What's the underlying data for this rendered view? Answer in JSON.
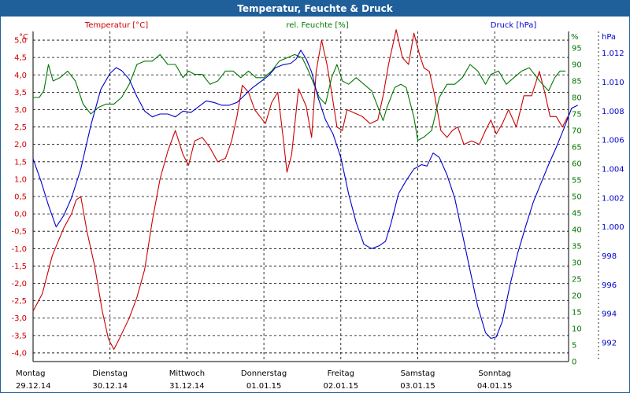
{
  "window": {
    "title": "Temperatur, Feuchte & Druck"
  },
  "colors": {
    "temperature": "#cc0000",
    "humidity": "#007700",
    "pressure": "#0000cc",
    "titlebar": "#1f5f9a",
    "grid": "#000000"
  },
  "chart_data": {
    "type": "line",
    "title": "Temperatur, Feuchte & Druck",
    "x_ticks": [
      {
        "day": "Montag",
        "date": "29.12.14"
      },
      {
        "day": "Dienstag",
        "date": "30.12.14"
      },
      {
        "day": "Mittwoch",
        "date": "31.12.14"
      },
      {
        "day": "Donnerstag",
        "date": "01.01.15"
      },
      {
        "day": "Freitag",
        "date": "02.01.15"
      },
      {
        "day": "Samstag",
        "date": "03.01.15"
      },
      {
        "day": "Sonntag",
        "date": "04.01.15"
      }
    ],
    "x_range_days": [
      0,
      7.1
    ],
    "axes": {
      "temperature": {
        "label": "Temperatur [°C]",
        "unit": "°C",
        "range": [
          -4.25,
          5.25
        ],
        "ticks": [
          "5,0",
          "4,5",
          "4,0",
          "3,5",
          "3,0",
          "2,5",
          "2,0",
          "1,5",
          "1,0",
          "0,5",
          "0,0",
          "-0,5",
          "-1,0",
          "-1,5",
          "-2,0",
          "-2,5",
          "-3,0",
          "-3,5",
          "-4,0"
        ]
      },
      "humidity": {
        "label": "rel. Feuchte [%]",
        "unit": "%",
        "range": [
          0,
          100
        ],
        "ticks": [
          "95",
          "90",
          "85",
          "80",
          "75",
          "70",
          "65",
          "60",
          "55",
          "50",
          "45",
          "40",
          "35",
          "30",
          "25",
          "20",
          "15",
          "10",
          "5",
          "0"
        ]
      },
      "pressure": {
        "label": "Druck [hPa]",
        "unit": "hPa",
        "range": [
          990.7,
          1013.5
        ],
        "ticks": [
          "1.012",
          "1.010",
          "1.008",
          "1.006",
          "1.004",
          "1.002",
          "1.000",
          "998",
          "996",
          "994",
          "992"
        ]
      }
    },
    "grid": true,
    "series": [
      {
        "name": "Temperatur [°C]",
        "axis": "temperature",
        "color": "#cc0000",
        "points": [
          [
            0.0,
            -2.8
          ],
          [
            0.12,
            -2.3
          ],
          [
            0.25,
            -1.2
          ],
          [
            0.4,
            -0.4
          ],
          [
            0.5,
            0.0
          ],
          [
            0.56,
            0.4
          ],
          [
            0.62,
            0.5
          ],
          [
            0.7,
            -0.5
          ],
          [
            0.8,
            -1.5
          ],
          [
            0.9,
            -2.8
          ],
          [
            0.98,
            -3.6
          ],
          [
            1.05,
            -3.9
          ],
          [
            1.12,
            -3.6
          ],
          [
            1.25,
            -3.0
          ],
          [
            1.35,
            -2.4
          ],
          [
            1.45,
            -1.6
          ],
          [
            1.55,
            -0.2
          ],
          [
            1.65,
            1.0
          ],
          [
            1.75,
            1.8
          ],
          [
            1.85,
            2.4
          ],
          [
            1.95,
            1.7
          ],
          [
            2.02,
            1.4
          ],
          [
            2.1,
            2.1
          ],
          [
            2.2,
            2.2
          ],
          [
            2.3,
            1.9
          ],
          [
            2.4,
            1.5
          ],
          [
            2.5,
            1.6
          ],
          [
            2.58,
            2.1
          ],
          [
            2.65,
            2.8
          ],
          [
            2.72,
            3.7
          ],
          [
            2.8,
            3.5
          ],
          [
            2.88,
            3.0
          ],
          [
            2.95,
            2.8
          ],
          [
            3.02,
            2.6
          ],
          [
            3.1,
            3.2
          ],
          [
            3.18,
            3.5
          ],
          [
            3.25,
            2.2
          ],
          [
            3.3,
            1.2
          ],
          [
            3.36,
            1.7
          ],
          [
            3.45,
            3.6
          ],
          [
            3.55,
            3.1
          ],
          [
            3.62,
            2.2
          ],
          [
            3.68,
            4.1
          ],
          [
            3.75,
            5.0
          ],
          [
            3.82,
            4.3
          ],
          [
            3.88,
            3.5
          ],
          [
            3.95,
            2.5
          ],
          [
            4.02,
            2.4
          ],
          [
            4.08,
            3.0
          ],
          [
            4.18,
            2.9
          ],
          [
            4.28,
            2.8
          ],
          [
            4.38,
            2.6
          ],
          [
            4.48,
            2.7
          ],
          [
            4.55,
            3.4
          ],
          [
            4.62,
            4.3
          ],
          [
            4.68,
            4.9
          ],
          [
            4.72,
            5.3
          ],
          [
            4.8,
            4.5
          ],
          [
            4.88,
            4.3
          ],
          [
            4.95,
            5.2
          ],
          [
            5.02,
            4.6
          ],
          [
            5.08,
            4.2
          ],
          [
            5.15,
            4.1
          ],
          [
            5.22,
            3.4
          ],
          [
            5.3,
            2.4
          ],
          [
            5.38,
            2.2
          ],
          [
            5.45,
            2.4
          ],
          [
            5.52,
            2.5
          ],
          [
            5.6,
            2.0
          ],
          [
            5.7,
            2.1
          ],
          [
            5.8,
            2.0
          ],
          [
            5.88,
            2.4
          ],
          [
            5.95,
            2.7
          ],
          [
            6.02,
            2.3
          ],
          [
            6.1,
            2.6
          ],
          [
            6.18,
            3.0
          ],
          [
            6.28,
            2.5
          ],
          [
            6.38,
            3.4
          ],
          [
            6.48,
            3.4
          ],
          [
            6.58,
            4.1
          ],
          [
            6.65,
            3.5
          ],
          [
            6.72,
            2.8
          ],
          [
            6.8,
            2.8
          ],
          [
            6.88,
            2.5
          ],
          [
            6.95,
            2.8
          ]
        ]
      },
      {
        "name": "rel. Feuchte [%]",
        "axis": "humidity",
        "color": "#007700",
        "points": [
          [
            0.0,
            80
          ],
          [
            0.08,
            80
          ],
          [
            0.14,
            82
          ],
          [
            0.2,
            90
          ],
          [
            0.26,
            85
          ],
          [
            0.35,
            86
          ],
          [
            0.45,
            88
          ],
          [
            0.55,
            85
          ],
          [
            0.65,
            78
          ],
          [
            0.75,
            75
          ],
          [
            0.85,
            77
          ],
          [
            0.95,
            78
          ],
          [
            1.05,
            78
          ],
          [
            1.15,
            80
          ],
          [
            1.25,
            84
          ],
          [
            1.35,
            90
          ],
          [
            1.45,
            91
          ],
          [
            1.55,
            91
          ],
          [
            1.65,
            93
          ],
          [
            1.75,
            90
          ],
          [
            1.85,
            90
          ],
          [
            1.95,
            86
          ],
          [
            2.02,
            88
          ],
          [
            2.1,
            87
          ],
          [
            2.2,
            87
          ],
          [
            2.3,
            84
          ],
          [
            2.4,
            85
          ],
          [
            2.5,
            88
          ],
          [
            2.6,
            88
          ],
          [
            2.7,
            86
          ],
          [
            2.8,
            88
          ],
          [
            2.9,
            86
          ],
          [
            3.0,
            86
          ],
          [
            3.1,
            88
          ],
          [
            3.2,
            91
          ],
          [
            3.3,
            92
          ],
          [
            3.4,
            93
          ],
          [
            3.5,
            92
          ],
          [
            3.58,
            88
          ],
          [
            3.65,
            84
          ],
          [
            3.72,
            80
          ],
          [
            3.8,
            78
          ],
          [
            3.88,
            86
          ],
          [
            3.95,
            90
          ],
          [
            4.02,
            85
          ],
          [
            4.1,
            84
          ],
          [
            4.2,
            86
          ],
          [
            4.3,
            84
          ],
          [
            4.4,
            82
          ],
          [
            4.5,
            76
          ],
          [
            4.55,
            73
          ],
          [
            4.6,
            77
          ],
          [
            4.7,
            83
          ],
          [
            4.78,
            84
          ],
          [
            4.85,
            83
          ],
          [
            4.95,
            74
          ],
          [
            5.0,
            67
          ],
          [
            5.08,
            68
          ],
          [
            5.18,
            70
          ],
          [
            5.28,
            80
          ],
          [
            5.38,
            84
          ],
          [
            5.48,
            84
          ],
          [
            5.58,
            86
          ],
          [
            5.68,
            90
          ],
          [
            5.78,
            88
          ],
          [
            5.88,
            84
          ],
          [
            5.95,
            87
          ],
          [
            6.05,
            88
          ],
          [
            6.15,
            84
          ],
          [
            6.25,
            86
          ],
          [
            6.35,
            88
          ],
          [
            6.45,
            89
          ],
          [
            6.55,
            86
          ],
          [
            6.62,
            84
          ],
          [
            6.7,
            82
          ],
          [
            6.78,
            86
          ],
          [
            6.85,
            88
          ],
          [
            6.92,
            88
          ]
        ]
      },
      {
        "name": "Druck [hPa]",
        "axis": "pressure",
        "color": "#0000cc",
        "points": [
          [
            0.0,
            1004.7
          ],
          [
            0.1,
            1003.2
          ],
          [
            0.2,
            1001.5
          ],
          [
            0.3,
            1000.0
          ],
          [
            0.4,
            1000.8
          ],
          [
            0.5,
            1002.0
          ],
          [
            0.62,
            1004.0
          ],
          [
            0.75,
            1007.0
          ],
          [
            0.88,
            1009.5
          ],
          [
            1.0,
            1010.6
          ],
          [
            1.08,
            1011.0
          ],
          [
            1.15,
            1010.8
          ],
          [
            1.25,
            1010.2
          ],
          [
            1.35,
            1009.0
          ],
          [
            1.45,
            1008.0
          ],
          [
            1.55,
            1007.6
          ],
          [
            1.65,
            1007.8
          ],
          [
            1.75,
            1007.8
          ],
          [
            1.85,
            1007.6
          ],
          [
            1.95,
            1008.0
          ],
          [
            2.05,
            1007.9
          ],
          [
            2.15,
            1008.3
          ],
          [
            2.25,
            1008.7
          ],
          [
            2.35,
            1008.6
          ],
          [
            2.45,
            1008.4
          ],
          [
            2.55,
            1008.4
          ],
          [
            2.65,
            1008.6
          ],
          [
            2.75,
            1009.1
          ],
          [
            2.85,
            1009.6
          ],
          [
            2.95,
            1010.0
          ],
          [
            3.05,
            1010.4
          ],
          [
            3.15,
            1011.0
          ],
          [
            3.25,
            1011.2
          ],
          [
            3.35,
            1011.3
          ],
          [
            3.42,
            1011.6
          ],
          [
            3.48,
            1012.2
          ],
          [
            3.55,
            1011.6
          ],
          [
            3.62,
            1010.7
          ],
          [
            3.7,
            1009.0
          ],
          [
            3.8,
            1007.4
          ],
          [
            3.9,
            1006.4
          ],
          [
            4.0,
            1004.8
          ],
          [
            4.1,
            1002.3
          ],
          [
            4.2,
            1000.3
          ],
          [
            4.3,
            998.8
          ],
          [
            4.4,
            998.5
          ],
          [
            4.5,
            998.7
          ],
          [
            4.58,
            999.0
          ],
          [
            4.65,
            1000.2
          ],
          [
            4.75,
            1002.3
          ],
          [
            4.85,
            1003.2
          ],
          [
            4.95,
            1004.0
          ],
          [
            5.05,
            1004.3
          ],
          [
            5.12,
            1004.2
          ],
          [
            5.2,
            1005.1
          ],
          [
            5.28,
            1004.8
          ],
          [
            5.38,
            1003.6
          ],
          [
            5.48,
            1002.0
          ],
          [
            5.58,
            999.5
          ],
          [
            5.68,
            997.0
          ],
          [
            5.78,
            994.5
          ],
          [
            5.88,
            992.7
          ],
          [
            5.95,
            992.3
          ],
          [
            6.02,
            992.4
          ],
          [
            6.1,
            993.5
          ],
          [
            6.2,
            996.0
          ],
          [
            6.3,
            998.2
          ],
          [
            6.4,
            1000.0
          ],
          [
            6.5,
            1001.7
          ],
          [
            6.6,
            1003.0
          ],
          [
            6.7,
            1004.3
          ],
          [
            6.8,
            1005.5
          ],
          [
            6.9,
            1006.8
          ],
          [
            7.0,
            1008.2
          ],
          [
            7.08,
            1008.4
          ]
        ]
      }
    ]
  }
}
